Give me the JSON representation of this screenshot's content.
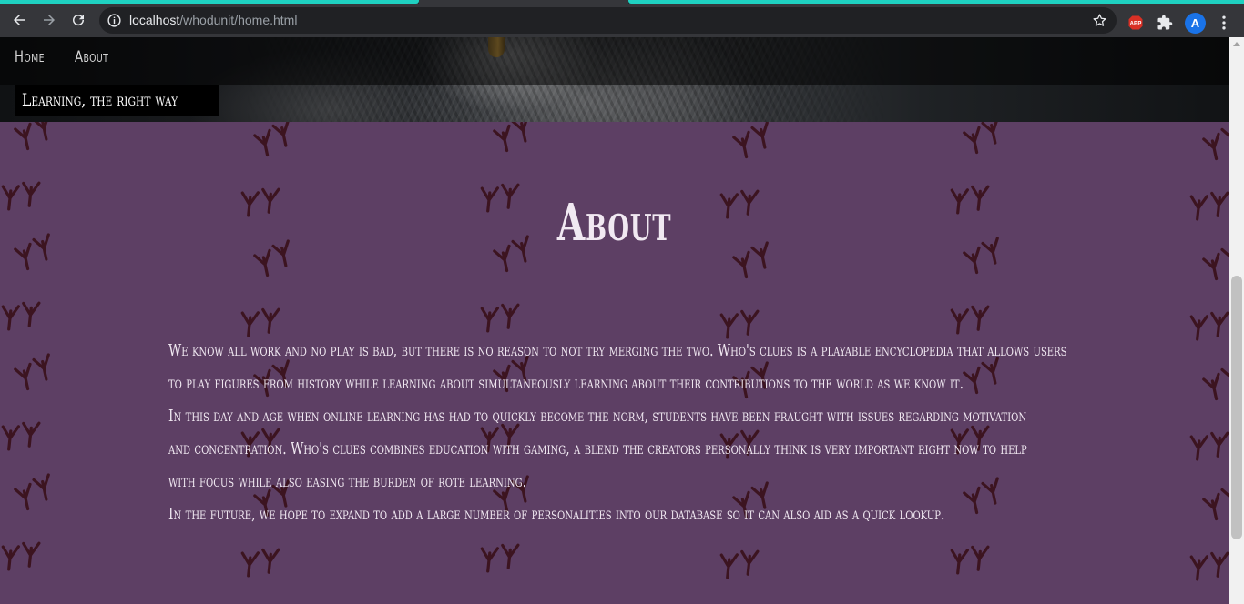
{
  "browser": {
    "url_host": "localhost",
    "url_path": "/whodunit/home.html",
    "profile_initial": "A",
    "icons": [
      "back-icon",
      "forward-icon",
      "reload-icon",
      "info-icon",
      "star-icon",
      "adblock-icon",
      "extensions-icon",
      "menu-icon"
    ]
  },
  "nav": {
    "home": "Home",
    "about": "About"
  },
  "hero": {
    "tagline": "Learning, the right way"
  },
  "about": {
    "title": "About",
    "paragraphs": [
      "We know all work and no play is bad, but there is no reason to not try merging the two. Who's clues is a playable encyclopedia that allows users",
      "to play figures from history while learning about simultaneously learning about their contributions to the world as we know it.",
      "In this day and age when online learning has had to quickly become the norm, students have been fraught with issues regarding motivation",
      "and concentration. Who's clues combines education with gaming, a blend the creators personally think is very important right now to help",
      "with focus while also easing the burden of rote learning.",
      "In the future, we hope to expand to add a large number of personalities into our database so it can also aid as a quick lookup."
    ]
  },
  "colors": {
    "accent": "#1fd1c1",
    "about_background": "#5d3f64",
    "footprint": "#3c1420",
    "text": "#f1e9f2"
  }
}
